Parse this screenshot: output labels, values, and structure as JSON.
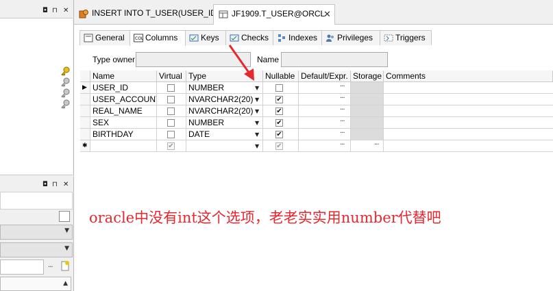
{
  "left_panel": {
    "top_buttons": [
      "◘",
      "⊓",
      "✕"
    ],
    "bottom_buttons": [
      "◘",
      "⊓",
      "✕"
    ]
  },
  "tabs": [
    {
      "label": "INSERT INTO T_USER(USER_ID ...",
      "active": false
    },
    {
      "label": "JF1909.T_USER@ORCL",
      "active": true
    }
  ],
  "subtabs": [
    "General",
    "Columns",
    "Keys",
    "Checks",
    "Indexes",
    "Privileges",
    "Triggers"
  ],
  "form": {
    "type_owner_label": "Type owner",
    "name_label": "Name"
  },
  "grid": {
    "headers": [
      "Name",
      "Virtual",
      "Type",
      "Nullable",
      "Default/Expr.",
      "Storage",
      "Comments"
    ],
    "rows": [
      {
        "name": "USER_ID",
        "type": "NUMBER",
        "nullable": false
      },
      {
        "name": "USER_ACCOUNT",
        "type": "NVARCHAR2(20)",
        "nullable": true
      },
      {
        "name": "REAL_NAME",
        "type": "NVARCHAR2(20)",
        "nullable": true
      },
      {
        "name": "SEX",
        "type": "NUMBER",
        "nullable": true
      },
      {
        "name": "BIRTHDAY",
        "type": "DATE",
        "nullable": true
      }
    ],
    "current_marker": "▶",
    "new_row_marker": "✱",
    "ellipsis": "···"
  },
  "annotation": "oracle中没有int这个选项，老老实实用number代替吧",
  "colors": {
    "annotation": "#e8262d",
    "arrow": "#e8262d"
  }
}
